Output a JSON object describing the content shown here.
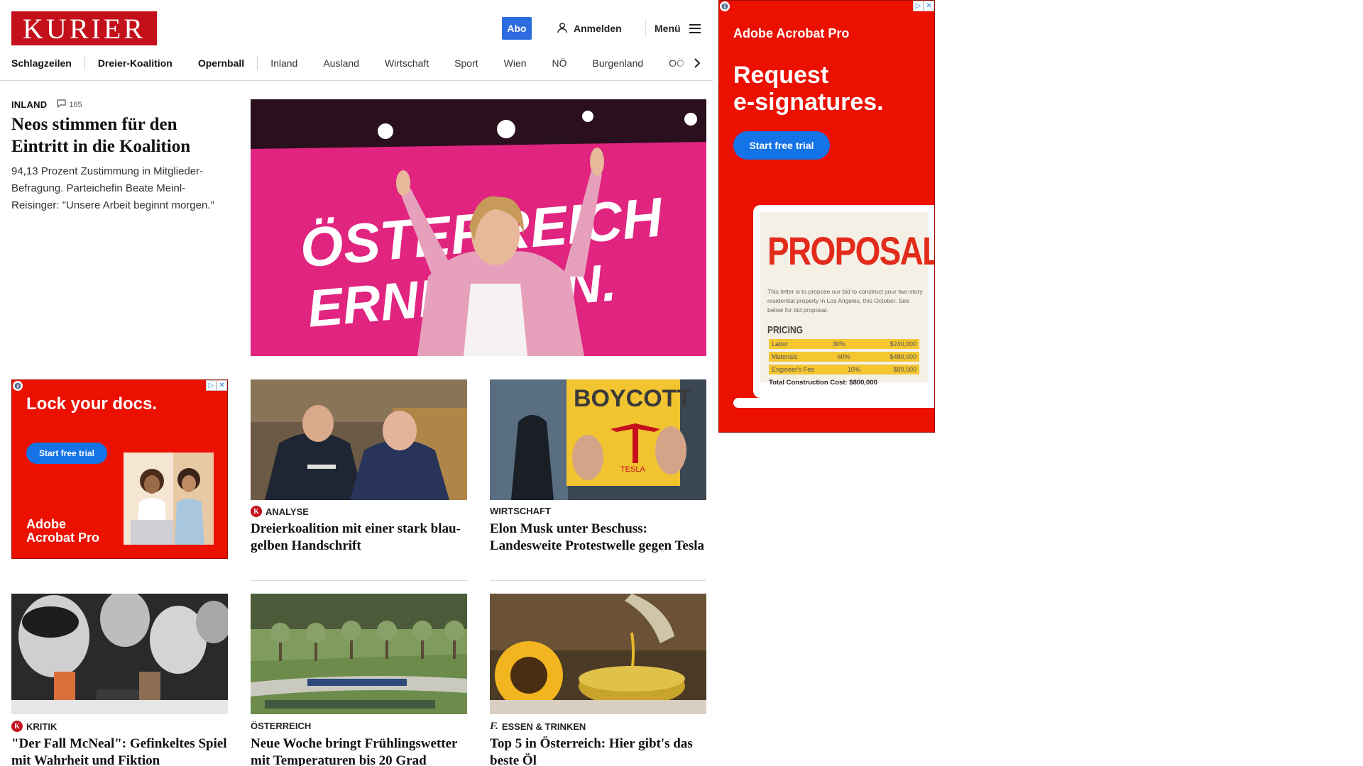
{
  "header": {
    "logo": "KURIER",
    "abo": "Abo",
    "login": "Anmelden",
    "menu": "Menü"
  },
  "nav": {
    "items": [
      "Schlagzeilen",
      "Dreier-Koalition",
      "Opernball",
      "Inland",
      "Ausland",
      "Wirtschaft",
      "Sport",
      "Wien",
      "NÖ",
      "Burgenland",
      "OÖ"
    ]
  },
  "lead": {
    "kicker": "INLAND",
    "comments": "165",
    "title": "Neos stimmen für den Eintritt in die Koalition",
    "teaser": "94,13 Prozent Zustimmung in Mitglieder-Befragung. Parteichefin Beate Meinl-Reisinger: \"Unsere Arbeit beginnt morgen.\"",
    "image_text_1": "ÖSTERREICH",
    "image_text_2": "ERNEUERN."
  },
  "cards": [
    {
      "label": "ANALYSE",
      "badge": "K",
      "title": "Dreierkoalition mit einer stark blau-gelben Handschrift"
    },
    {
      "label": "WIRTSCHAFT",
      "title": "Elon Musk unter Beschuss: Landesweite Protestwelle gegen Tesla",
      "sign_text": "BOYCOTT",
      "sign_sub": "TESLA"
    },
    {
      "label": "KRITIK",
      "badge": "K",
      "title": "\"Der Fall McNeal\": Gefinkeltes Spiel mit Wahrheit und Fiktion"
    },
    {
      "label": "ÖSTERREICH",
      "title": "Neue Woche bringt Frühlingswetter mit Temperaturen bis 20 Grad"
    },
    {
      "label": "ESSEN & TRINKEN",
      "badge": "f.",
      "title": "Top 5 in Österreich: Hier gibt's das beste Öl"
    }
  ],
  "ad_small": {
    "headline": "Lock your docs.",
    "cta": "Start free trial",
    "brand_line1": "Adobe",
    "brand_line2": "Acrobat Pro"
  },
  "ad_big": {
    "brand": "Adobe Acrobat Pro",
    "headline_line1": "Request",
    "headline_line2": "e-signatures.",
    "cta": "Start free trial",
    "doc_title": "PROPOSAL",
    "doc_body": "This letter is to propose our bid to construct your two-story residential property in Los Angeles, this October. See below for bid proposal.",
    "pricing_label": "PRICING",
    "rows": [
      {
        "item": "Labor",
        "pct": "30%",
        "amount": "$240,000"
      },
      {
        "item": "Materials",
        "pct": "60%",
        "amount": "$480,000"
      },
      {
        "item": "Engineer's Fee",
        "pct": "10%",
        "amount": "$80,000"
      }
    ],
    "total": "Total Construction Cost: $800,000"
  },
  "colors": {
    "brand_red": "#c4101b",
    "abo_blue": "#2d6cdf",
    "ad_red": "#eb1000",
    "ad_button": "#1473e6"
  }
}
